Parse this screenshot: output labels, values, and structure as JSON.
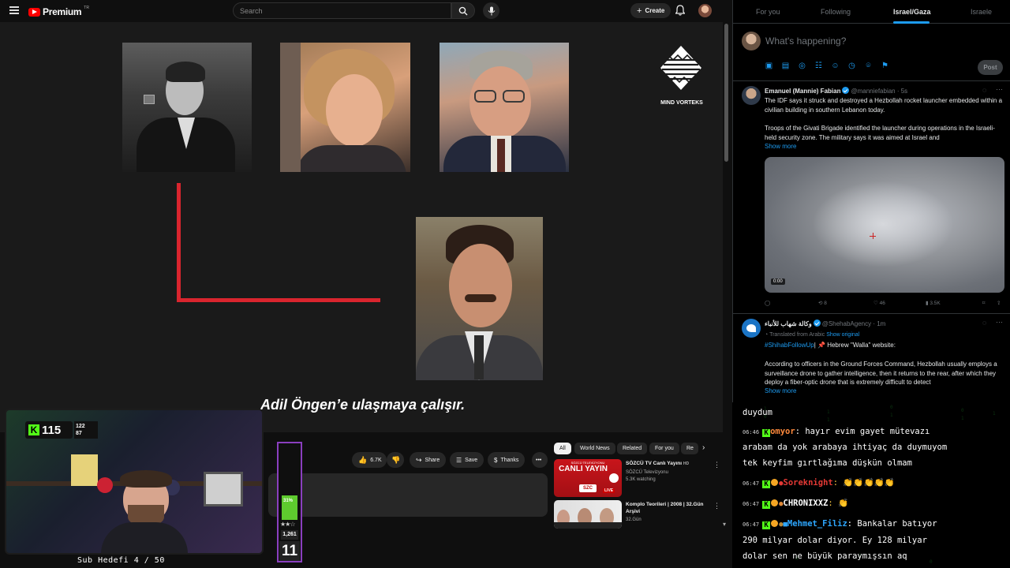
{
  "youtube": {
    "logo_text": "Premium",
    "region": "TR",
    "search_placeholder": "Search",
    "create_label": "Create",
    "video": {
      "channel_logo_text": "MIND VORTEKS",
      "subtitle": "Adil Öngen’e ulaşmaya çalışır."
    },
    "actions": {
      "likes": "6.7K",
      "share": "Share",
      "save": "Save",
      "thanks": "Thanks"
    },
    "chips": [
      "All",
      "World News",
      "Related",
      "For you",
      "Re"
    ],
    "recommendations": [
      {
        "title": "SÖZCÜ TV Canlı Yayını",
        "hd": "HD",
        "channel": "SÖZCÜ Televizyonu",
        "meta": "5.3K watching",
        "thumb_text": "CANLI YAYIN",
        "thumb_brand": "SZC",
        "live_label": "LIVE",
        "thumb_top": "SÖZCÜ TELEVİZYONU"
      },
      {
        "title": "Komplo Teorileri | 2008 | 32.Gün Arşivi",
        "channel": "32.Gün"
      }
    ]
  },
  "stream_overlay": {
    "kick_viewers": "115",
    "stat_a": "122",
    "stat_b": "87",
    "sub_goal": "Sub Hedefi 4 / 50",
    "meter_percent": "31%",
    "meter_count": "1,261",
    "meter_number": "11"
  },
  "twitter": {
    "tabs": [
      "For you",
      "Following",
      "Israel/Gaza",
      "Israele"
    ],
    "active_tab": "Israel/Gaza",
    "compose_placeholder": "What's happening?",
    "post_label": "Post",
    "tweets": [
      {
        "name": "Emanuel (Mannie) Fabian",
        "handle": "@manniefabian · 5s",
        "text1": "The IDF says it struck and destroyed a Hezbollah rocket launcher embedded within a civilian building in southern Lebanon today.",
        "text2": "Troops of the Givati Brigade identified the launcher during operations in the Israeli-held security zone. The military says it was aimed at Israel and",
        "show_more": "Show more",
        "video_time": "0:00",
        "reposts": "8",
        "likes": "46",
        "views": "3.5K"
      },
      {
        "name": "وكالة شهاب للأنباء",
        "handle": "@ShehabAgency · 1m",
        "translated": "Translated from Arabic",
        "show_original": "Show original",
        "hashtag": "#ShihabFollowUp",
        "hashtag_rest": "| 📌 Hebrew \"Walla\" website:",
        "text": "According to officers in the Ground Forces Command, Hezbollah usually employs a surveillance drone to gather intelligence, then it returns to the rear, after which they deploy a fiber-optic drone that is extremely difficult to detect",
        "show_more": "Show more"
      }
    ]
  },
  "chat": {
    "lines": [
      {
        "text": "duydum"
      },
      {
        "time": "06:46",
        "user": "omyor",
        "msg": ": hayır evim gayet mütevazı"
      },
      {
        "text": "arabam da yok arabaya ihtiyaç da duymuyom"
      },
      {
        "text": "tek keyfim gırtlağıma düşkün olmam"
      },
      {
        "time": "06:47",
        "user": "Soreknight",
        "msg": ": 👏👏👏👏👏"
      },
      {
        "time": "06:47",
        "user": "CHRONIXXZ",
        "msg": ": 👏"
      },
      {
        "time": "06:47",
        "user": "Mehmet_Filiz",
        "msg": ": Bankalar batıyor"
      },
      {
        "text": "290 milyar dolar diyor. Ey 128 milyar"
      },
      {
        "text": "dolar sen ne büyük paraymışsın aq"
      }
    ]
  },
  "colors": {
    "youtube_red": "#ff0000",
    "twitter_blue": "#1d9bf0",
    "kick_green": "#53fc18",
    "accent_red_line": "#d9252e",
    "meter_border": "#8a3fbf"
  }
}
